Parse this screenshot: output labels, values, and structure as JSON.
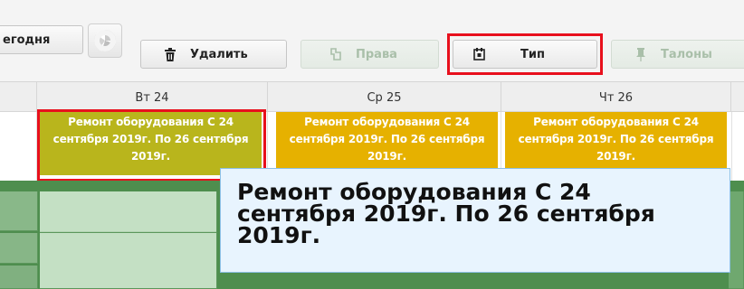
{
  "toolbar": {
    "today_label": "егодня",
    "delete_label": "Удалить",
    "rights_label": "Права",
    "type_label": "Тип",
    "tickets_label": "Талоны"
  },
  "days": [
    {
      "label": "Вт 24"
    },
    {
      "label": "Ср 25"
    },
    {
      "label": "Чт 26"
    }
  ],
  "events": [
    {
      "text": "Ремонт оборудования С 24 сентября 2019г. По 26 сентября 2019г.",
      "color": "#b9b51c"
    },
    {
      "text": "Ремонт оборудования С 24 сентября 2019г. По 26 сентября 2019г.",
      "color": "#e6b100"
    },
    {
      "text": "Ремонт оборудования С 24 сентября 2019г. По 26 сентября 2019г.",
      "color": "#e6b100"
    }
  ],
  "tooltip": {
    "text": "Ремонт оборудования С 24 сентября 2019г. По 26 сентября 2019г."
  },
  "colors": {
    "highlight": "#e8101d",
    "work_hours": "#4e8e4e",
    "tooltip_bg": "#e8f4fe"
  },
  "icons": {
    "delete": "trash-icon",
    "rights": "key-icon",
    "type": "calendar-icon",
    "tickets": "pin-icon",
    "refresh": "refresh-icon"
  }
}
